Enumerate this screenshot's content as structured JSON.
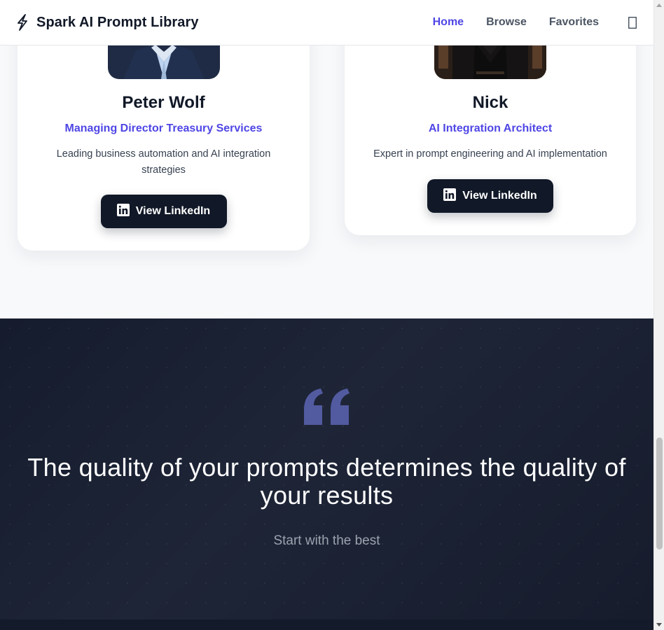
{
  "header": {
    "brand_icon": "lightning-bolt-icon",
    "title": "Spark AI Prompt Library",
    "nav": [
      {
        "label": "Home",
        "active": true
      },
      {
        "label": "Browse",
        "active": false
      },
      {
        "label": "Favorites",
        "active": false
      }
    ],
    "theme_toggle_icon": "moon-icon"
  },
  "team": {
    "members": [
      {
        "name": "Peter Wolf",
        "role": "Managing Director Treasury Services",
        "bio": "Leading business automation and AI integration strategies",
        "button_label": "View LinkedIn",
        "button_icon": "linkedin-icon"
      },
      {
        "name": "Nick",
        "role": "AI Integration Architect",
        "bio": "Expert in prompt engineering and AI implementation",
        "button_label": "View LinkedIn",
        "button_icon": "linkedin-icon"
      }
    ]
  },
  "quote": {
    "icon": "quote-icon",
    "text": "The quality of your prompts determines the quality of your results",
    "subtext": "Start with the best"
  },
  "colors": {
    "accent": "#4f46e5",
    "dark": "#111827",
    "quote_bg": "#1e2537",
    "quote_mark": "#525aa0"
  }
}
